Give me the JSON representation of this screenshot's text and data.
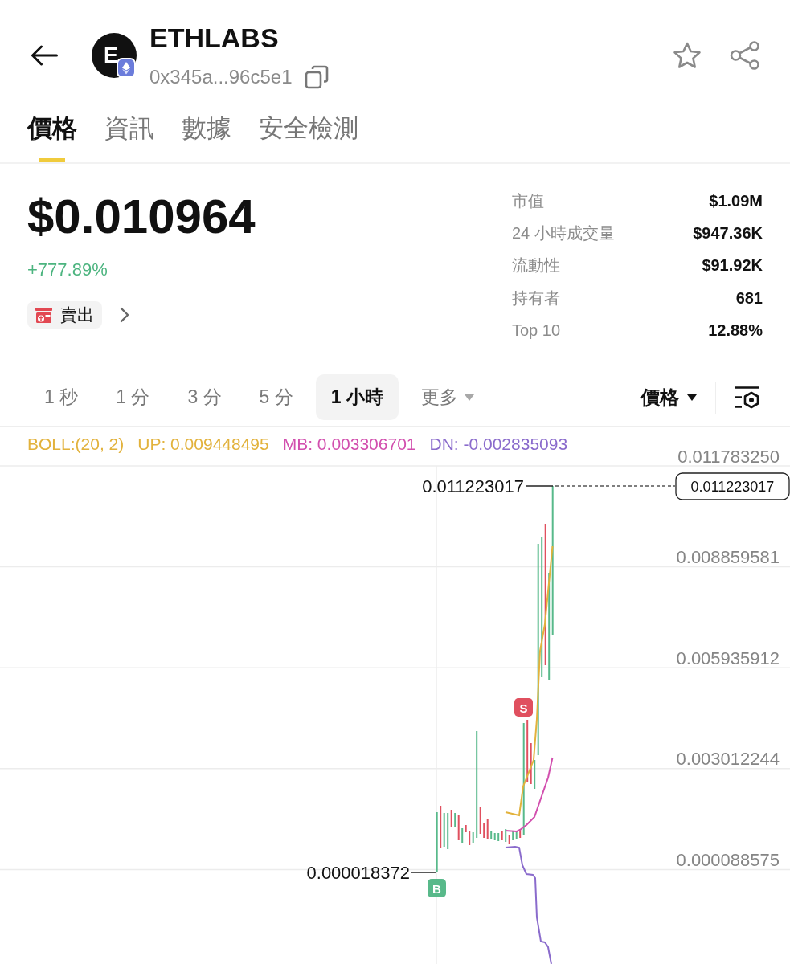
{
  "header": {
    "logo_letter": "E",
    "title": "ETHLABS",
    "address": "0x345a...96c5e1"
  },
  "tabs": [
    {
      "label": "價格",
      "selected": true
    },
    {
      "label": "資訊",
      "selected": false
    },
    {
      "label": "數據",
      "selected": false
    },
    {
      "label": "安全檢測",
      "selected": false
    }
  ],
  "summary": {
    "price": "$0.010964",
    "change": "+777.89%",
    "sell_button": "賣出"
  },
  "stats": [
    {
      "label": "市值",
      "value": "$1.09M"
    },
    {
      "label": "24 小時成交量",
      "value": "$947.36K"
    },
    {
      "label": "流動性",
      "value": "$91.92K"
    },
    {
      "label": "持有者",
      "value": "681"
    },
    {
      "label": "Top 10",
      "value": "12.88%"
    }
  ],
  "timeframes": [
    {
      "label": "1 秒",
      "kind": "option",
      "selected": false
    },
    {
      "label": "1 分",
      "kind": "option",
      "selected": false
    },
    {
      "label": "3 分",
      "kind": "option",
      "selected": false
    },
    {
      "label": "5 分",
      "kind": "option",
      "selected": false
    },
    {
      "label": "1 小時",
      "kind": "option",
      "selected": true
    },
    {
      "label": "更多",
      "kind": "dropdown",
      "selected": false
    }
  ],
  "chart_toolbar": {
    "chart_type": "價格"
  },
  "chart": {
    "legend": [
      {
        "text": "BOLL:(20, 2)",
        "color": "#e2b23c"
      },
      {
        "text": "UP: 0.009448495",
        "color": "#e2b23c"
      },
      {
        "text": "MB: 0.003306701",
        "color": "#d24fae"
      },
      {
        "text": "DN: -0.002835093",
        "color": "#8a6bcc"
      }
    ],
    "y_axis_labels": [
      "0.011783250",
      "0.008859581",
      "0.005935912",
      "0.003012244",
      "0.000088575"
    ],
    "high_label": "0.011223017",
    "low_label": "0.000018372",
    "last_price_tag": "0.011223017",
    "sell_marker": "S",
    "buy_marker": "B"
  }
}
